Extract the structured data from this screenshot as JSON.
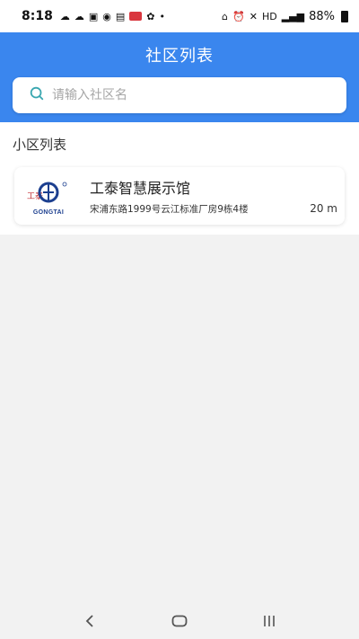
{
  "status_bar": {
    "time": "8:18",
    "network": "HD",
    "battery_percent": "88%"
  },
  "header": {
    "title": "社区列表"
  },
  "search": {
    "placeholder": "请输入社区名"
  },
  "section": {
    "title": "小区列表"
  },
  "communities": [
    {
      "logo_text": "GONGTAI",
      "logo_chars": "工泰",
      "name": "工泰智慧展示馆",
      "address": "宋浦东路1999号云江标准厂房9栋4楼",
      "distance": "20 m"
    }
  ],
  "colors": {
    "primary": "#3a86ee",
    "logo_blue": "#1c3f8f",
    "logo_red": "#c0272d"
  },
  "icons": {
    "search": "search-icon",
    "back": "back-icon",
    "home": "home-icon",
    "recents": "recents-icon"
  }
}
